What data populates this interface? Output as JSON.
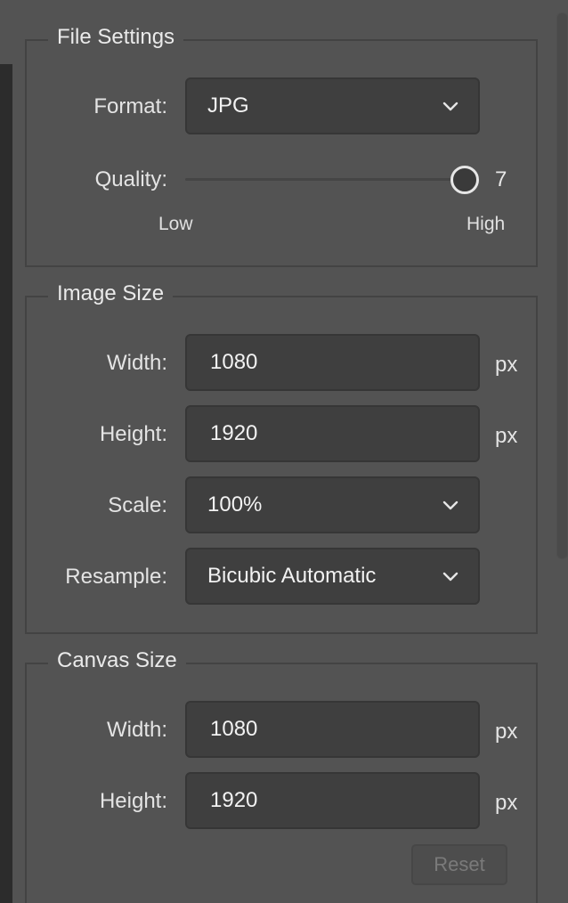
{
  "file_settings": {
    "title": "File Settings",
    "format_label": "Format:",
    "format_value": "JPG",
    "quality_label": "Quality:",
    "quality_value": "7",
    "quality_level": 1.0,
    "quality_min_label": "Low",
    "quality_max_label": "High"
  },
  "image_size": {
    "title": "Image Size",
    "width_label": "Width:",
    "width_value": "1080",
    "width_unit": "px",
    "height_label": "Height:",
    "height_value": "1920",
    "height_unit": "px",
    "scale_label": "Scale:",
    "scale_value": "100%",
    "resample_label": "Resample:",
    "resample_value": "Bicubic Automatic"
  },
  "canvas_size": {
    "title": "Canvas Size",
    "width_label": "Width:",
    "width_value": "1080",
    "width_unit": "px",
    "height_label": "Height:",
    "height_value": "1920",
    "height_unit": "px",
    "reset_label": "Reset"
  },
  "colors": {
    "panel_bg": "#535353",
    "field_bg": "#3f3f3f",
    "border": "#434343",
    "text": "#e4e4e4",
    "disabled_text": "#7a7a7a"
  }
}
